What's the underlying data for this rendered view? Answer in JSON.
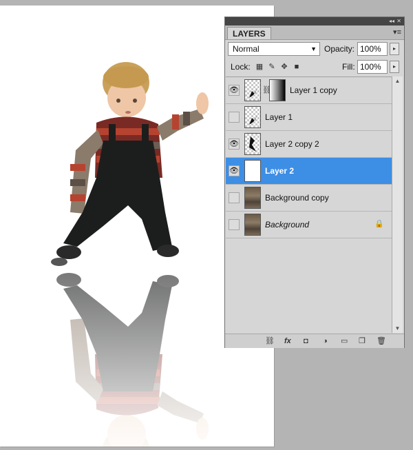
{
  "panel": {
    "tab_label": "LAYERS",
    "collapse_icon": "collapse-arrows-icon",
    "menu_icon": "panel-menu-icon"
  },
  "blend": {
    "mode": "Normal",
    "opacity_label": "Opacity:",
    "opacity_value": "100%"
  },
  "lock": {
    "label": "Lock:",
    "icons": [
      "lock-transparent-icon",
      "lock-image-icon",
      "lock-position-icon",
      "lock-all-icon"
    ],
    "fill_label": "Fill:",
    "fill_value": "100%"
  },
  "layers": [
    {
      "name": "Layer 1 copy",
      "visible": true,
      "thumb": "child-cutout",
      "mask": true,
      "selected": false
    },
    {
      "name": "Layer 1",
      "visible": false,
      "thumb": "child-cutout",
      "mask": false,
      "selected": false
    },
    {
      "name": "Layer 2 copy 2",
      "visible": true,
      "thumb": "child-cutout",
      "mask": false,
      "selected": false
    },
    {
      "name": "Layer 2",
      "visible": true,
      "thumb": "white-fill",
      "mask": false,
      "selected": true
    },
    {
      "name": "Background copy",
      "visible": false,
      "thumb": "photo",
      "mask": false,
      "selected": false
    },
    {
      "name": "Background",
      "visible": false,
      "thumb": "photo",
      "mask": false,
      "selected": false,
      "locked": true
    }
  ],
  "footer_icons": [
    "link-layers-icon",
    "layer-style-fx-icon",
    "add-mask-icon",
    "adjustment-layer-icon",
    "new-group-icon",
    "new-layer-icon",
    "delete-layer-icon"
  ],
  "colors": {
    "selection": "#3d8ee5",
    "panel_bg": "#d6d6d6",
    "workspace_bg": "#b4b4b4"
  }
}
